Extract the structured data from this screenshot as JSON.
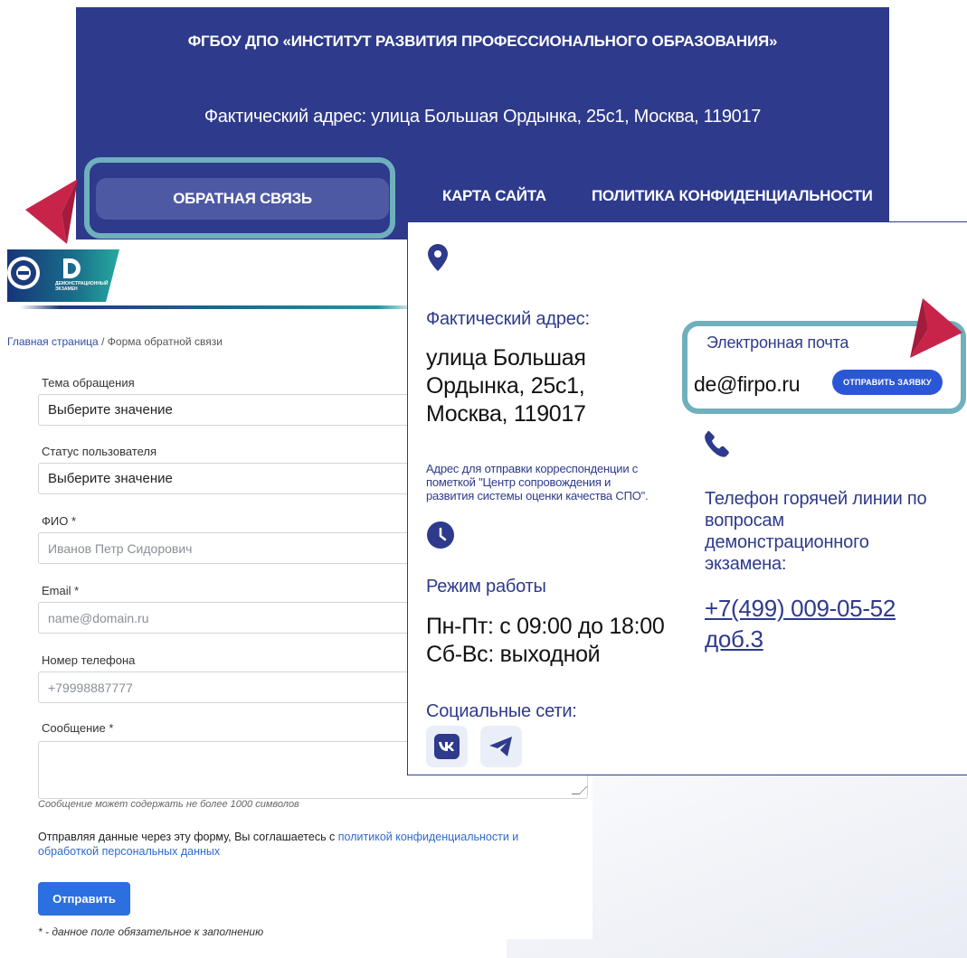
{
  "footer": {
    "organization": "ФГБОУ ДПО «ИНСТИТУТ РАЗВИТИЯ ПРОФЕССИОНАЛЬНОГО ОБРАЗОВАНИЯ»",
    "address": "Фактический адрес: улица Большая Ордынка, 25с1, Москва, 119017",
    "links": {
      "feedback": "ОБРАТНАЯ СВЯЗЬ",
      "sitemap": "КАРТА САЙТА",
      "privacy": "ПОЛИТИКА КОНФИДЕНЦИАЛЬНОСТИ"
    }
  },
  "logo": {
    "exam_text_line1": "ДЕМОНСТРАЦИОННЫЙ",
    "exam_text_line2": "ЭКЗАМЕН"
  },
  "breadcrumb": {
    "home": "Главная страница",
    "separator": "/",
    "current": "Форма обратной связи"
  },
  "form": {
    "subject_label": "Тема обращения",
    "subject_value": "Выберите значение",
    "status_label": "Статус пользователя",
    "status_value": "Выберите значение",
    "name_label": "ФИО *",
    "name_placeholder": "Иванов Петр Сидорович",
    "email_label": "Email *",
    "email_placeholder": "name@domain.ru",
    "phone_label": "Номер телефона",
    "phone_placeholder": "+79998887777",
    "message_label": "Сообщение *",
    "message_hint": "Сообщение может содержать не более 1000 символов",
    "consent_prefix": "Отправляя данные через эту форму, Вы соглашаетесь с ",
    "consent_link": "политикой конфиденциальности и обработкой персональных данных",
    "submit_label": "Отправить",
    "required_note": "* - данное поле обязательное к заполнению"
  },
  "contacts": {
    "address_title": "Фактический адрес:",
    "address_line1": "улица Большая",
    "address_line2": "Ордынка, 25с1,",
    "address_line3": "Москва, 119017",
    "mail_note_line1": "Адрес для отправки корреспонденции с",
    "mail_note_line2": "пометкой \"Центр сопровождения и",
    "mail_note_line3": "развития системы оценки качества СПО\".",
    "hours_title": "Режим работы",
    "hours_line1": "Пн-Пт: с 09:00 до 18:00",
    "hours_line2": "Сб-Вс: выходной",
    "social_title": "Социальные сети:",
    "email_title": "Электронная почта",
    "email_value": "de@firpo.ru",
    "email_button": "ОТПРАВИТЬ ЗАЯВКУ",
    "hotline_line1": "Телефон горячей линии по",
    "hotline_line2": "вопросам",
    "hotline_line3": "демонстрационного",
    "hotline_line4": "экзамена:",
    "phone_line1": "+7(499) 009-05-52",
    "phone_line2": "доб.3"
  },
  "colors": {
    "footer_bg": "#2e3a8c",
    "highlight": "#6fb0bd",
    "pointer": "#c8244a",
    "primary_button": "#2b6fe0"
  }
}
